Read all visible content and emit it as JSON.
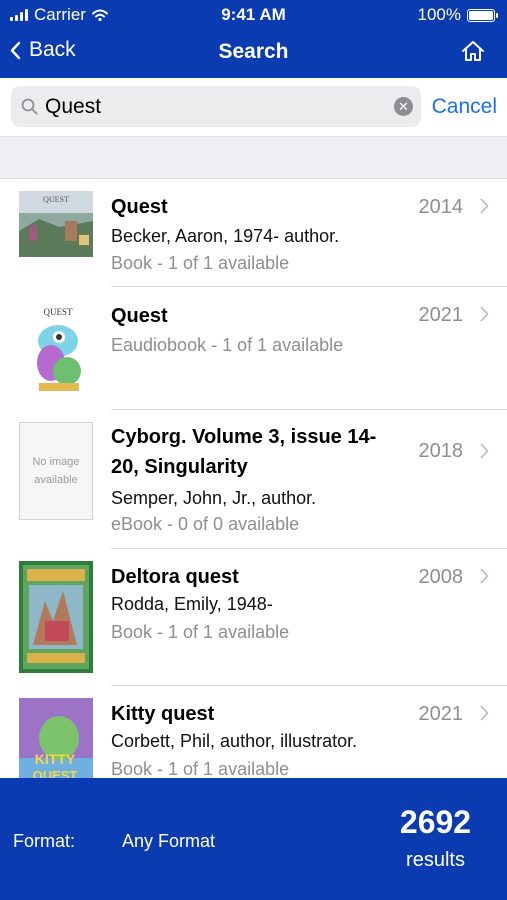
{
  "status_bar": {
    "carrier": "Carrier",
    "time": "9:41 AM",
    "battery": "100%"
  },
  "nav": {
    "back_label": "Back",
    "title": "Search"
  },
  "search": {
    "value": "Quest",
    "placeholder": "Search",
    "cancel_label": "Cancel"
  },
  "results": [
    {
      "title": "Quest",
      "line2": "Becker, Aaron, 1974- author.",
      "line3": "Book - 1 of 1 available",
      "year": "2014"
    },
    {
      "title": "Quest",
      "line2": "Eaudiobook - 1 of 1 available",
      "line3": "",
      "year": "2021"
    },
    {
      "title": "Cyborg. Volume 3, issue 14-20, Singularity",
      "line2": "Semper, John, Jr., author.",
      "line3": "eBook - 0 of 0 available",
      "year": "2018",
      "cover_text_1": "No image",
      "cover_text_2": "available"
    },
    {
      "title": "Deltora quest",
      "line2": "Rodda, Emily, 1948-",
      "line3": "Book - 1 of 1 available",
      "year": "2008"
    },
    {
      "title": "Kitty quest",
      "line2": "Corbett, Phil, author, illustrator.",
      "line3": "Book - 1 of 1 available",
      "year": "2021"
    }
  ],
  "footer": {
    "format_label": "Format:",
    "format_value": "Any Format",
    "count": "2692",
    "count_label": "results"
  },
  "colors": {
    "brand_blue": "#0a3bb0",
    "link_blue": "#1b6ff3",
    "secondary_gray": "#8e8e93"
  }
}
